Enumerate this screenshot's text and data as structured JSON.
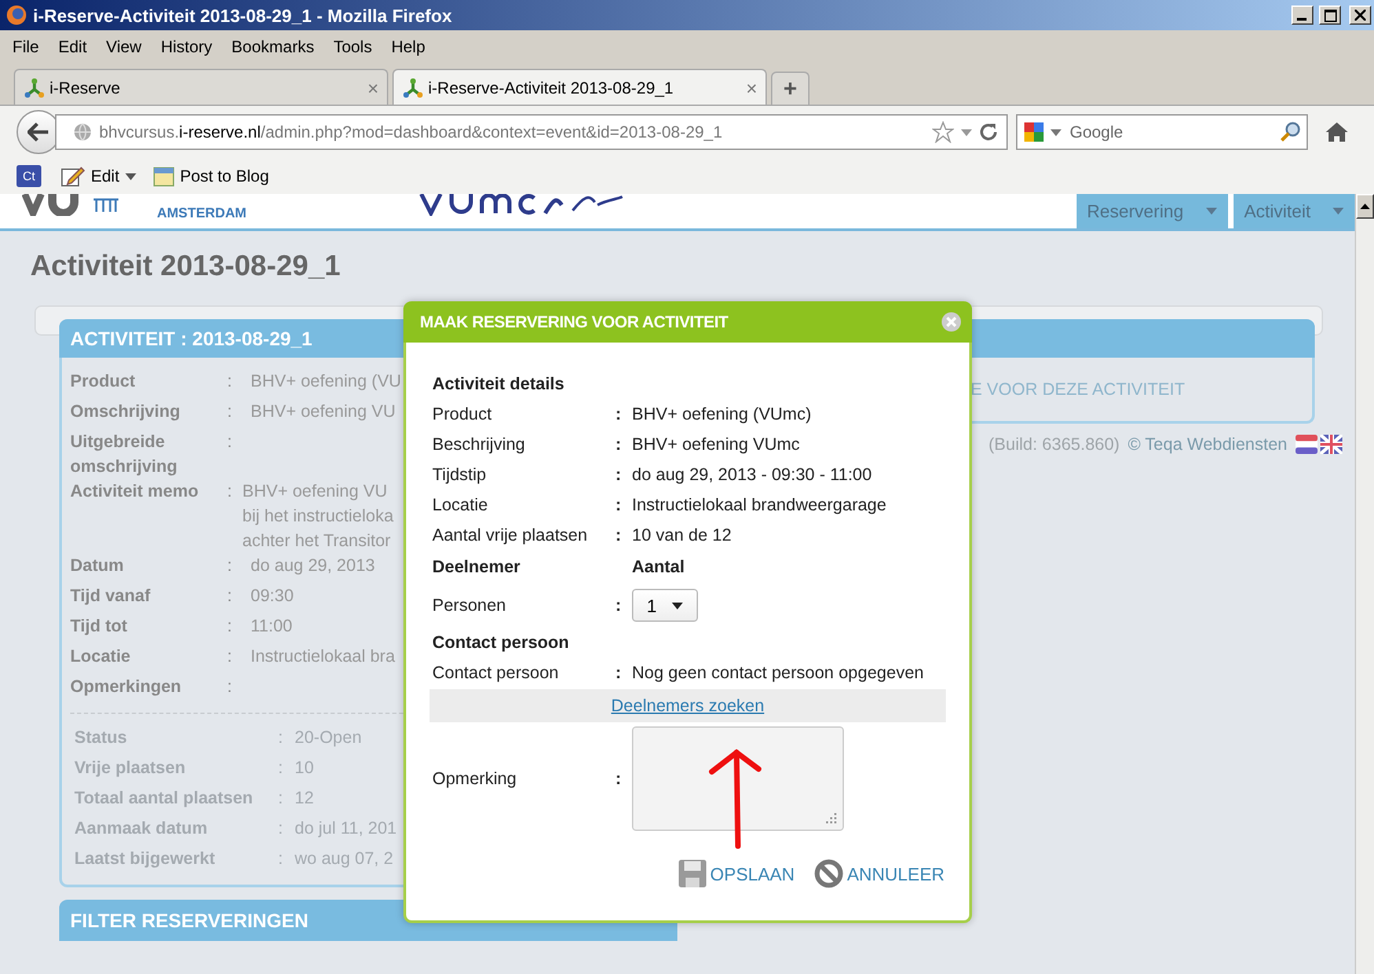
{
  "window": {
    "title": "i-Reserve-Activiteit 2013-08-29_1 - Mozilla Firefox"
  },
  "menu": [
    "File",
    "Edit",
    "View",
    "History",
    "Bookmarks",
    "Tools",
    "Help"
  ],
  "browser_tabs": [
    {
      "label": "i-Reserve",
      "close": "×",
      "selected": false
    },
    {
      "label": "i-Reserve-Activiteit 2013-08-29_1",
      "close": "×",
      "selected": true
    }
  ],
  "new_tab": "+",
  "address_bar": {
    "url_parts": [
      {
        "text": "bhvcursus.",
        "emphasis": false
      },
      {
        "text": "i-reserve.nl",
        "emphasis": true
      },
      {
        "text": "/admin.php?mod=dashboard&context=event&id=2013-08-29_1",
        "emphasis": false
      }
    ]
  },
  "search_box": {
    "placeholder": "Google"
  },
  "bookmarks_bar": {
    "badge": "Ct",
    "items": [
      {
        "label": "Edit",
        "kind": "menu"
      },
      {
        "label": "Post to Blog",
        "kind": "link"
      }
    ]
  },
  "site": {
    "logos": [
      "AMSTERDAM"
    ],
    "nav": [
      "Reservering",
      "Activiteit"
    ]
  },
  "page_title": "Activiteit 2013-08-29_1",
  "activity_panel": {
    "title": "ACTIVITEIT : 2013-08-29_1",
    "fields": [
      {
        "label": "Product",
        "sep": ":",
        "lines": [
          "BHV+ oefening (VU"
        ]
      },
      {
        "label": "Omschrijving",
        "sep": ":",
        "lines": [
          "BHV+ oefening VU"
        ]
      },
      {
        "label": "Uitgebreide omschrijving",
        "sep": ":"
      },
      {
        "label": "Activiteit memo",
        "sep": ":",
        "lines": [
          "BHV+ oefening VU",
          "bij het instructieloka",
          "achter het Transitor"
        ]
      },
      {
        "label": "Datum",
        "sep": ":",
        "lines": [
          "do aug 29, 2013"
        ]
      },
      {
        "label": "Tijd vanaf",
        "sep": ":",
        "lines": [
          "09:30"
        ]
      },
      {
        "label": "Tijd tot",
        "sep": ":",
        "lines": [
          "11:00"
        ]
      },
      {
        "label": "Locatie",
        "sep": ":",
        "lines": [
          "Instructielokaal bra"
        ]
      },
      {
        "label": "Opmerkingen",
        "sep": ":"
      }
    ],
    "meta": [
      {
        "label": "Status",
        "sep": ":",
        "value": "20-Open"
      },
      {
        "label": "Vrije plaatsen",
        "sep": ":",
        "value": "10"
      },
      {
        "label": "Totaal aantal plaatsen",
        "sep": ":",
        "value": "12"
      },
      {
        "label": "Aanmaak datum",
        "sep": ":",
        "value": "do jul 11, 201"
      },
      {
        "label": "Laatst bijgewerkt",
        "sep": ":",
        "value": "wo aug 07, 2"
      }
    ]
  },
  "reservations_panel": {
    "message": "E VOOR DEZE ACTIVITEIT"
  },
  "footer": {
    "build": "(Build: 6365.860)",
    "copyright": "© Teqa Webdiensten"
  },
  "filter_panel": {
    "title": "FILTER RESERVERINGEN"
  },
  "dialog": {
    "title": "MAAK RESERVERING VOOR ACTIVITEIT",
    "details_heading": "Activiteit details",
    "details": [
      {
        "label": "Product",
        "sep": ":",
        "value": "BHV+ oefening (VUmc)"
      },
      {
        "label": "Beschrijving",
        "sep": ":",
        "value": "BHV+ oefening VUmc"
      },
      {
        "label": "Tijdstip",
        "sep": ":",
        "value": "do aug 29, 2013 - 09:30 - 11:00"
      },
      {
        "label": "Locatie",
        "sep": ":",
        "value": "Instructielokaal brandweergarage"
      },
      {
        "label": "Aantal vrije plaatsen",
        "sep": ":",
        "value": "10 van de 12"
      }
    ],
    "participant_heading": "Deelnemer",
    "count_heading": "Aantal",
    "persons": {
      "label": "Personen",
      "sep": ":",
      "value": "1"
    },
    "contact_heading": "Contact persoon",
    "contact": {
      "label": "Contact persoon",
      "sep": ":",
      "value": "Nog geen contact persoon opgegeven"
    },
    "search_link": "Deelnemers zoeken",
    "remark": {
      "label": "Opmerking",
      "sep": ":"
    },
    "buttons": [
      {
        "label": "OPSLAAN",
        "kind": "save"
      },
      {
        "label": "ANNULEER",
        "kind": "cancel"
      }
    ]
  }
}
